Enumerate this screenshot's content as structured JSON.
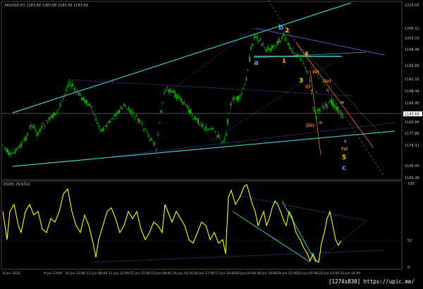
{
  "window": {
    "symbol_header": "XAUUSD,H1  1183.60  1183.88  1183.49  1183.69",
    "rsi_label": "RSI(8) 29.6314"
  },
  "price_axis": {
    "ticks": [
      "1213.05",
      "1206.31",
      "1203.15",
      "1199.46",
      "1195.65",
      "1191.16",
      "1188.44",
      "1186.40",
      "1180.84",
      "1177.88",
      "1174.31",
      "1169.95",
      "1166.48"
    ],
    "current_price": "1183.69"
  },
  "rsi_axis": {
    "ticks": [
      "100",
      "52",
      "0"
    ]
  },
  "time_axis": {
    "labels": [
      "8 Jun 2015",
      "9 Jun 13:00",
      "10 Jun 13:00",
      "11 Jun 06:00",
      "11 Jun 22:00",
      "12 Jun 15:00",
      "15 Jun 08:00",
      "16 Jun 01:00",
      "16 Jun 17:00",
      "17 Jun 10:00",
      "18 Jun 03:00",
      "18 Jun 19:00",
      "19 Jun 12:00",
      "22 Jun 05:00",
      "22 Jun 21:00",
      "23 Jun 14:00"
    ]
  },
  "wave_labels": {
    "a": "a",
    "b": "b",
    "n2": "2",
    "n1": "1",
    "n4": "4",
    "n3": "3",
    "ii": "(ii)",
    "iv": "(iv)",
    "i": "(i)",
    "iii": "(iii)",
    "v": "(v)",
    "n5": "5",
    "c": "c",
    "sm_i": "i",
    "sm_ii": "ii",
    "sm_iii": "iii",
    "sm_iv": "iv",
    "sm_v": "v"
  },
  "watermark": "[1274x830] https://upic.me/",
  "colors": {
    "background": "#000000",
    "bull_candle": "#00dc00",
    "bear_candle": "#00c000",
    "trendline": "#40c8c8",
    "rsi_line": "#ffff00",
    "wave_a_b_c": "#4aa8ff",
    "wave_numbers": "#ffc000",
    "wave_roman": "#ff8c20",
    "wave_small": "#c060c0",
    "grid_text": "#c0c0c0"
  }
}
